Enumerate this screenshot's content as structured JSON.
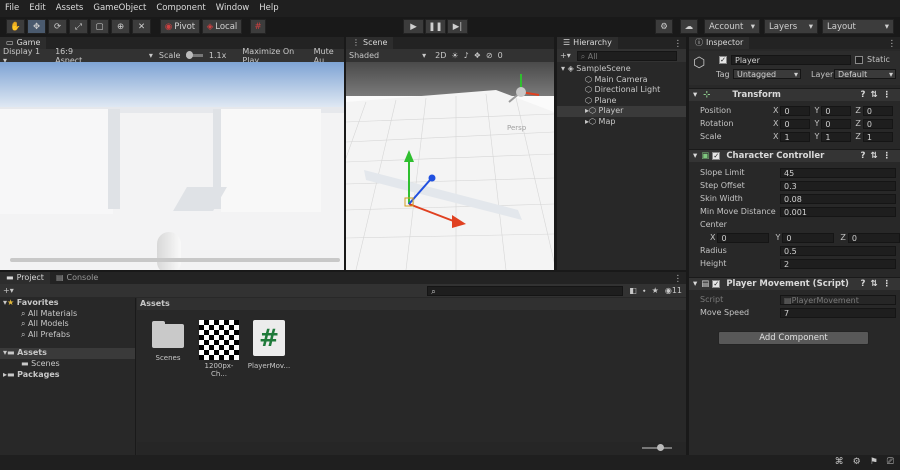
{
  "menu": [
    "File",
    "Edit",
    "Assets",
    "GameObject",
    "Component",
    "Window",
    "Help"
  ],
  "toolbar": {
    "pivot": "Pivot",
    "local": "Local",
    "account": "Account",
    "layers": "Layers",
    "layout": "Layout"
  },
  "game": {
    "tab": "Game",
    "display": "Display 1",
    "aspect": "16:9 Aspect",
    "scale_label": "Scale",
    "scale_value": "1.1x",
    "maximize": "Maximize On Play",
    "mute": "Mute Au"
  },
  "scene": {
    "tab": "Scene",
    "shading": "Shaded",
    "mode2d": "2D",
    "gizmo_count": "0",
    "persp": "Persp"
  },
  "hierarchy": {
    "tab": "Hierarchy",
    "search_placeholder": "All",
    "scene": "SampleScene",
    "items": [
      "Main Camera",
      "Directional Light",
      "Plane",
      "Player",
      "Map"
    ]
  },
  "inspector": {
    "tab": "Inspector",
    "object_name": "Player",
    "static_label": "Static",
    "tag_label": "Tag",
    "tag_value": "Untagged",
    "layer_label": "Layer",
    "layer_value": "Default",
    "transform": {
      "title": "Transform",
      "position_label": "Position",
      "rotation_label": "Rotation",
      "scale_label": "Scale",
      "position": [
        "0",
        "0",
        "0"
      ],
      "rotation": [
        "0",
        "0",
        "0"
      ],
      "scale": [
        "1",
        "1",
        "1"
      ]
    },
    "cc": {
      "title": "Character Controller",
      "rows": [
        {
          "label": "Slope Limit",
          "value": "45"
        },
        {
          "label": "Step Offset",
          "value": "0.3"
        },
        {
          "label": "Skin Width",
          "value": "0.08"
        },
        {
          "label": "Min Move Distance",
          "value": "0.001"
        }
      ],
      "center_label": "Center",
      "center": [
        "0",
        "0",
        "0"
      ],
      "radius_label": "Radius",
      "radius": "0.5",
      "height_label": "Height",
      "height": "2"
    },
    "pm": {
      "title": "Player Movement (Script)",
      "script_label": "Script",
      "script_value": "PlayerMovement",
      "speed_label": "Move Speed",
      "speed_value": "7"
    },
    "add_component": "Add Component"
  },
  "project": {
    "tab_project": "Project",
    "tab_console": "Console",
    "favorites": "Favorites",
    "fav_items": [
      "All Materials",
      "All Models",
      "All Prefabs"
    ],
    "assets": "Assets",
    "asset_sub": [
      "Scenes"
    ],
    "packages": "Packages",
    "breadcrumb": "Assets",
    "hidden_count": "11",
    "files": [
      {
        "name": "Scenes",
        "icon": "folder-icon"
      },
      {
        "name": "1200px-Ch...",
        "icon": "checker-texture-icon"
      },
      {
        "name": "PlayerMov...",
        "icon": "csharp-script-icon"
      }
    ]
  },
  "colors": {
    "selection": "#2c5d87",
    "panel": "#282828",
    "accent_red": "#d04040"
  }
}
